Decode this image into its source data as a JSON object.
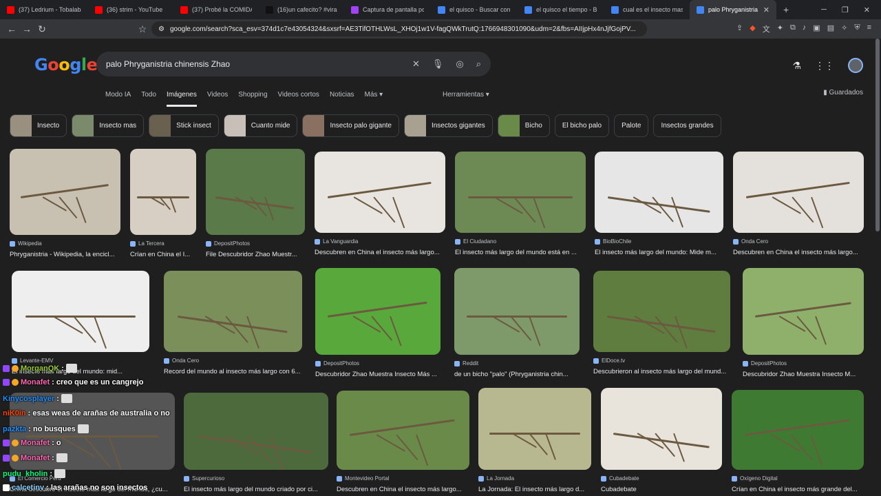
{
  "browser": {
    "tabs": [
      {
        "title": "(37) Ledrium - Tobalaba, M",
        "color": "#ff0000"
      },
      {
        "title": "(36) strim - YouTube",
        "color": "#ff0000"
      },
      {
        "title": "(37) Probé la COMIDA",
        "color": "#ff0000"
      },
      {
        "title": "(16)un cafecito? #viral #pa",
        "color": "#111111"
      },
      {
        "title": "Captura de pantalla por Li",
        "color": "#a142f4"
      },
      {
        "title": "el quisco - Buscar con Goo",
        "color": "#4285f4"
      },
      {
        "title": "el quisco el tiempo - Busc",
        "color": "#4285f4"
      },
      {
        "title": "cual es el insecto mas gra",
        "color": "#4285f4"
      },
      {
        "title": "palo Phryganistria chi",
        "color": "#4285f4",
        "active": true
      }
    ],
    "url": "google.com/search?sca_esv=374d1c7e43054324&sxsrf=AE3TifOTHLWsL_XHOj1w1V-fagQWkTrutQ:1766948301090&udm=2&fbs=AIIjpHx4nJjfGojPV..."
  },
  "google": {
    "logo": "Google",
    "query": "palo Phryganistria chinensis Zhao",
    "tabs": [
      "Modo IA",
      "Todo",
      "Imágenes",
      "Videos",
      "Shopping",
      "Videos cortos",
      "Noticias",
      "Más"
    ],
    "tools": "Herramientas",
    "saved": "Guardados",
    "chips": [
      {
        "label": "Insecto",
        "thumb": true
      },
      {
        "label": "Insecto mas",
        "thumb": true
      },
      {
        "label": "Stick insect",
        "thumb": true
      },
      {
        "label": "Cuanto mide",
        "thumb": true
      },
      {
        "label": "Insecto palo gigante",
        "thumb": true
      },
      {
        "label": "Insectos gigantes",
        "thumb": true
      },
      {
        "label": "Bicho",
        "thumb": true
      },
      {
        "label": "El bicho palo",
        "thumb": false
      },
      {
        "label": "Palote",
        "thumb": false
      },
      {
        "label": "Insectos grandes",
        "thumb": false
      }
    ],
    "results": [
      {
        "source": "Wikipedia",
        "caption": "Phryganistria - Wikipedia, la encicl...",
        "bg": "#c8c0b0"
      },
      {
        "source": "La Tercera",
        "caption": "Crían en China el I...",
        "bg": "#d8cfc4"
      },
      {
        "source": "DepositPhotos",
        "caption": "File Descubridor Zhao Muestr...",
        "bg": "#5a7a4a"
      },
      {
        "source": "La Vanguardia",
        "caption": "Descubren en China el insecto más largo...",
        "bg": "#e8e4e0"
      },
      {
        "source": "El Ciudadano",
        "caption": "El insecto más largo del mundo está en ...",
        "bg": "#6d8a55"
      },
      {
        "source": "BioBioChile",
        "caption": "El insecto más largo del mundo: Mide m...",
        "bg": "#e6e6e6"
      },
      {
        "source": "Onda Cero",
        "caption": "Descubren en China el insecto más largo...",
        "bg": "#e4e0dc"
      },
      {
        "source": "Levante-EMV",
        "caption": "El insecto más largo del mundo: mid...",
        "bg": "#eeeeee"
      },
      {
        "source": "Onda Cero",
        "caption": "Record del mundo al insecto más largo con 6...",
        "bg": "#7a8f5a"
      },
      {
        "source": "DepositPhotos",
        "caption": "Descubridor Zhao Muestra Insecto Más ...",
        "bg": "#58a83c"
      },
      {
        "source": "Reddit",
        "caption": "de un bicho \"palo\" (Phryganistria chin...",
        "bg": "#7f9a6a"
      },
      {
        "source": "ElDoce.tv",
        "caption": "Descubrieron al insecto más largo del mund...",
        "bg": "#5e7d3e"
      },
      {
        "source": "DepositPhotos",
        "caption": "Descubridor Zhao Muestra Insecto M...",
        "bg": "#8fb06a"
      },
      {
        "source": "El Comercio Perú",
        "caption": "China descubre el insecto más largo del mundo, ¿cu...",
        "bg": "#555555"
      },
      {
        "source": "Supercurioso",
        "caption": "El insecto más largo del mundo criado por ci...",
        "bg": "#4c6a3c"
      },
      {
        "source": "Montevideo Portal",
        "caption": "Descubren en China el insecto más largo...",
        "bg": "#6a8a4a"
      },
      {
        "source": "La Jornada",
        "caption": "La Jornada: El insecto más largo d...",
        "bg": "#b8b890"
      },
      {
        "source": "Cubadebate",
        "caption": "Cubadebate",
        "bg": "#e8e4dc"
      },
      {
        "source": "Oxígeno Digital",
        "caption": "Crían en China el insecto más grande del...",
        "bg": "#3f7a32"
      }
    ]
  },
  "chat": [
    {
      "user": "MorganQK",
      "text": ":",
      "color": "#9acd32"
    },
    {
      "user": "Monafet",
      "text": ": creo que es un cangrejo",
      "color": "#ff69b4"
    },
    {
      "user": "Kinycosplayer",
      "text": ":",
      "color": "#1e90ff"
    },
    {
      "user": "niK0in",
      "text": ": esas weas de arañas de australia o no",
      "color": "#ff4500"
    },
    {
      "user": "pazkta",
      "text": ": no busques",
      "color": "#1e90ff"
    },
    {
      "user": "Monafet",
      "text": ": o",
      "color": "#ff69b4"
    },
    {
      "user": "Monafet",
      "text": ":",
      "color": "#ff69b4"
    },
    {
      "user": "pudu_kholin",
      "text": ":",
      "color": "#00ff7f"
    },
    {
      "user": "calcetinv",
      "text": ": las arañas no son insectos",
      "color": "#87cefa"
    }
  ]
}
